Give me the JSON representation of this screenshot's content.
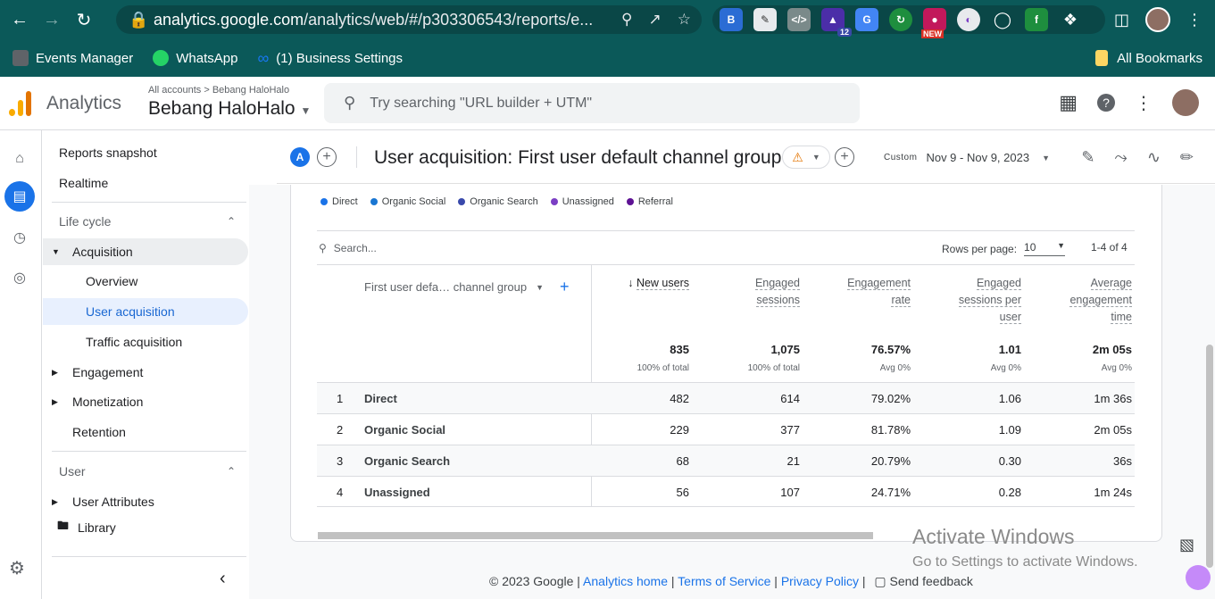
{
  "browser": {
    "url_host": "analytics.google.com",
    "url_path": "/analytics/web/#/p303306543/reports/e...",
    "bookmarks": [
      "Events Manager",
      "WhatsApp",
      "(1) Business Settings"
    ],
    "all_bookmarks": "All Bookmarks",
    "ext_badge": "12",
    "ext_new": "NEW"
  },
  "header": {
    "app_name": "Analytics",
    "breadcrumb": "All accounts > Bebang HaloHalo",
    "property": "Bebang HaloHalo",
    "search_placeholder": "Try searching \"URL builder + UTM\""
  },
  "sidebar": {
    "reports_snapshot": "Reports snapshot",
    "realtime": "Realtime",
    "lifecycle": "Life cycle",
    "acquisition": "Acquisition",
    "overview": "Overview",
    "user_acquisition": "User acquisition",
    "traffic_acquisition": "Traffic acquisition",
    "engagement": "Engagement",
    "monetization": "Monetization",
    "retention": "Retention",
    "user": "User",
    "user_attributes": "User Attributes",
    "library": "Library"
  },
  "report": {
    "comparison_chip": "A",
    "title": "User acquisition: First user default channel group",
    "custom_label": "Custom",
    "date_range": "Nov 9 - Nov 9, 2023"
  },
  "legend": [
    {
      "label": "Direct",
      "color": "#1a73e8"
    },
    {
      "label": "Organic Social",
      "color": "#1976d2"
    },
    {
      "label": "Organic Search",
      "color": "#3949ab"
    },
    {
      "label": "Unassigned",
      "color": "#7b3fc4"
    },
    {
      "label": "Referral",
      "color": "#5e1294"
    }
  ],
  "table": {
    "search_placeholder": "Search...",
    "rows_per_page_label": "Rows per page:",
    "rows_per_page": "10",
    "pager": "1-4 of 4",
    "dimension_header": "First user defa… channel group",
    "metrics": [
      {
        "lines": [
          "New users"
        ],
        "total": "835",
        "total_sub": "100% of total"
      },
      {
        "lines": [
          "Engaged",
          "sessions"
        ],
        "total": "1,075",
        "total_sub": "100% of total"
      },
      {
        "lines": [
          "Engagement",
          "rate"
        ],
        "total": "76.57%",
        "total_sub": "Avg 0%"
      },
      {
        "lines": [
          "Engaged",
          "sessions per",
          "user"
        ],
        "total": "1.01",
        "total_sub": "Avg 0%"
      },
      {
        "lines": [
          "Average",
          "engagement",
          "time"
        ],
        "total": "2m 05s",
        "total_sub": "Avg 0%"
      }
    ],
    "rows": [
      {
        "idx": "1",
        "name": "Direct",
        "values": [
          "482",
          "614",
          "79.02%",
          "1.06",
          "1m 36s"
        ]
      },
      {
        "idx": "2",
        "name": "Organic Social",
        "values": [
          "229",
          "377",
          "81.78%",
          "1.09",
          "2m 05s"
        ]
      },
      {
        "idx": "3",
        "name": "Organic Search",
        "values": [
          "68",
          "21",
          "20.79%",
          "0.30",
          "36s"
        ]
      },
      {
        "idx": "4",
        "name": "Unassigned",
        "values": [
          "56",
          "107",
          "24.71%",
          "0.28",
          "1m 24s"
        ]
      }
    ]
  },
  "footer": {
    "copyright": "© 2023 Google |",
    "analytics_home": "Analytics home",
    "terms": "Terms of Service",
    "privacy": "Privacy Policy",
    "send_feedback": "Send feedback"
  },
  "watermark": {
    "line1": "Activate Windows",
    "line2": "Go to Settings to activate Windows."
  }
}
